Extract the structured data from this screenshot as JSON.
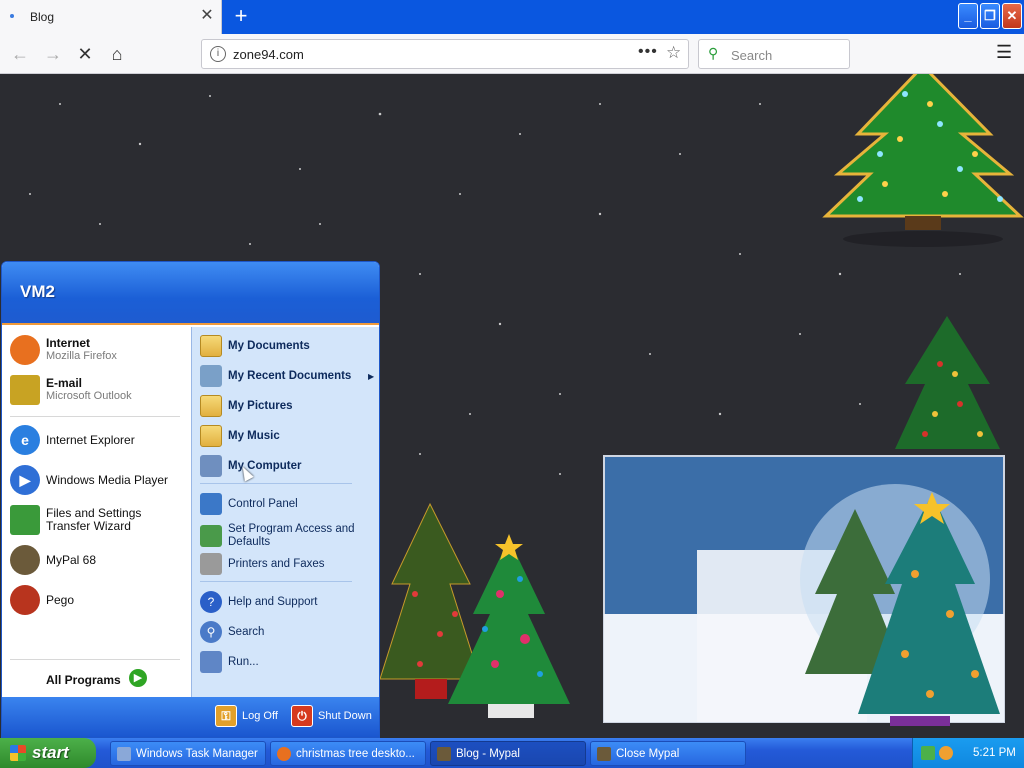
{
  "browser": {
    "tab": {
      "title": "Blog",
      "close": "✕"
    },
    "new_tab": "+",
    "window_buttons": {
      "minimize": "_",
      "restore": "❐",
      "close": "✕"
    },
    "nav": {
      "back": "←",
      "forward": "→",
      "stop": "✕",
      "home": "⌂"
    },
    "url": "zone94.com",
    "page_actions": "•••",
    "bookmark_star": "☆",
    "search": {
      "placeholder": "Search",
      "icon": "search-icon"
    },
    "menu": "☰"
  },
  "start_menu": {
    "user": "VM2",
    "left_items": [
      {
        "title": "Internet",
        "subtitle": "Mozilla Firefox",
        "icon": "firefox-icon",
        "color": "#e8701f",
        "bold": true
      },
      {
        "title": "E-mail",
        "subtitle": "Microsoft Outlook",
        "icon": "outlook-icon",
        "color": "#c8a323",
        "bold": true
      },
      {
        "title": "Internet Explorer",
        "icon": "internet-explorer-icon",
        "color": "#2a7fe0"
      },
      {
        "title": "Windows Media Player",
        "icon": "media-player-icon",
        "color": "#2f6fd6"
      },
      {
        "title": "Files and Settings Transfer Wizard",
        "icon": "transfer-wizard-icon",
        "color": "#3a9a3a"
      },
      {
        "title": "MyPal 68",
        "icon": "mypal-icon",
        "color": "#6b5a3a"
      },
      {
        "title": "Pego",
        "icon": "pego-icon",
        "color": "#b8341e"
      }
    ],
    "all_programs": "All Programs",
    "right_items": [
      {
        "title": "My Documents",
        "icon": "folder-icon",
        "bold": true
      },
      {
        "title": "My Recent Documents",
        "icon": "recent-documents-icon",
        "bold": true
      },
      {
        "title": "My Pictures",
        "icon": "folder-icon",
        "bold": true
      },
      {
        "title": "My Music",
        "icon": "folder-icon",
        "bold": true
      },
      {
        "title": "My Computer",
        "icon": "computer-icon",
        "bold": true
      },
      {
        "title": "Control Panel",
        "icon": "control-panel-icon"
      },
      {
        "title": "Set Program Access and Defaults",
        "icon": "program-access-icon"
      },
      {
        "title": "Printers and Faxes",
        "icon": "printer-icon"
      },
      {
        "title": "Help and Support",
        "icon": "help-icon"
      },
      {
        "title": "Search",
        "icon": "search-icon"
      },
      {
        "title": "Run...",
        "icon": "run-icon"
      }
    ],
    "log_off": "Log Off",
    "shut_down": "Shut Down"
  },
  "taskbar": {
    "start": "start",
    "tasks": [
      {
        "label": "Windows Task Manager",
        "active": false
      },
      {
        "label": "christmas tree deskto...",
        "active": false
      },
      {
        "label": "Blog - Mypal",
        "active": true
      },
      {
        "label": "Close Mypal",
        "active": false
      }
    ],
    "clock": "5:21 PM"
  },
  "colors": {
    "desktop": "#2b2c31",
    "taskbar": "#245ad8",
    "start_button": "#3a9b37",
    "start_menu_right": "#d3e5fa"
  }
}
